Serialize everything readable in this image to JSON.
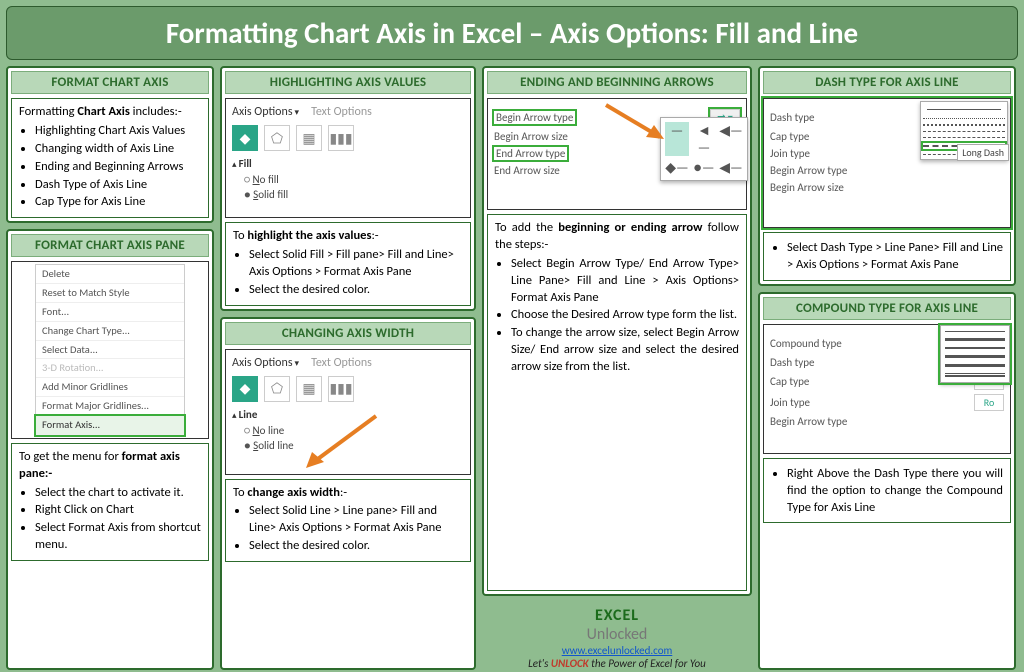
{
  "title": "Formatting Chart Axis in Excel – Axis Options: Fill and Line",
  "sections": {
    "fca": {
      "title": "FORMAT CHART AXIS",
      "lead": "Formatting ",
      "lead_b": "Chart Axis",
      "lead_tail": " includes:-",
      "items": [
        "Highlighting Chart Axis Values",
        "Changing width of Axis Line",
        "Ending and Beginning Arrows",
        "Dash Type of Axis Line",
        "Cap Type for Axis Line"
      ]
    },
    "pane": {
      "title": "FORMAT CHART AXIS PANE",
      "ctx": [
        "Delete",
        "Reset to Match Style",
        "Font...",
        "Change Chart Type...",
        "Select Data...",
        "3-D Rotation...",
        "Add Minor Gridlines",
        "Format Major Gridlines...",
        "Format Axis..."
      ],
      "lead": "To get the menu for ",
      "lead_b": "format axis pane:-",
      "items": [
        "Select the chart to activate it.",
        "Right Click on Chart",
        "Select Format Axis from shortcut menu."
      ]
    },
    "highlight": {
      "title": "HIGHLIGHTING AXIS VALUES",
      "tabs": [
        "Axis Options",
        "Text Options"
      ],
      "group": "Fill",
      "radios": [
        "No fill",
        "Solid fill"
      ],
      "lead": "To ",
      "lead_b": "highlight the axis values",
      "lead_tail": ":-",
      "items": [
        "Select Solid Fill > Fill pane> Fill and Line> Axis Options > Format Axis Pane",
        "Select the desired color."
      ]
    },
    "width": {
      "title": "CHANGING AXIS WIDTH",
      "tabs": [
        "Axis Options",
        "Text Options"
      ],
      "group": "Line",
      "radios": [
        "No line",
        "Solid line"
      ],
      "lead": "To ",
      "lead_b": "change axis width",
      "lead_tail": ":-",
      "items": [
        "Select Solid Line > Line pane> Fill and Line> Axis Options > Format Axis Pane",
        "Select the desired color."
      ]
    },
    "arrows": {
      "title": "ENDING AND BEGINNING ARROWS",
      "rows": [
        "Begin Arrow type",
        "Begin Arrow size",
        "End Arrow type",
        "End Arrow size"
      ],
      "lead": "To add the ",
      "lead_b": "beginning or ending arrow",
      "lead_tail": " follow the steps:-",
      "items": [
        "Select Begin Arrow Type/ End Arrow Type> Line Pane> Fill and Line > Axis Options> Format Axis Pane",
        "Choose the Desired Arrow type form the list.",
        "To change the arrow size, select Begin Arrow Size/ End arrow size and select the desired arrow size from the list."
      ]
    },
    "dash": {
      "title": "DASH TYPE FOR AXIS LINE",
      "rows": [
        "Dash type",
        "Cap type",
        "Join type",
        "Begin Arrow type",
        "Begin Arrow size"
      ],
      "long_dash": "Long Dash",
      "items": [
        "Select Dash Type > Line Pane> Fill and Line >  Axis Options > Format Axis Pane"
      ]
    },
    "compound": {
      "title": "COMPOUND TYPE FOR AXIS LINE",
      "rows": [
        "Compound type",
        "Dash type",
        "Cap type",
        "Join type",
        "Begin Arrow type"
      ],
      "row_vals": {
        "cap": "Fla",
        "join": "Ro"
      },
      "items": [
        "Right Above the Dash Type there you will find the option to change the Compound Type for Axis Line"
      ]
    }
  },
  "footer": {
    "logo1": "EXCEL",
    "logo2": "Unlocked",
    "url": "www.excelunlocked.com",
    "tag_pre": "Let's ",
    "tag_b": "UNLOCK",
    "tag_post": " the Power of Excel for You"
  }
}
